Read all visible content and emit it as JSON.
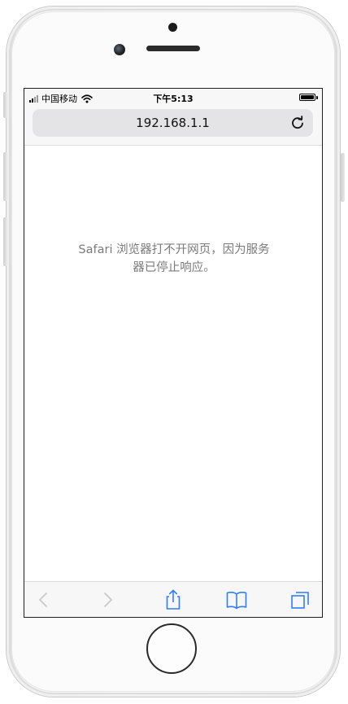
{
  "status_bar": {
    "carrier": "中国移动",
    "time": "下午5:13",
    "icons": {
      "signal": "signal-bars-icon",
      "wifi": "wifi-icon",
      "battery": "battery-icon"
    },
    "battery_level": 1.0
  },
  "address_bar": {
    "url": "192.168.1.1",
    "reload_icon": "reload-icon"
  },
  "page": {
    "error_line1": "Safari 浏览器打不开网页，因为服务",
    "error_line2": "器已停止响应。"
  },
  "toolbar": {
    "items": [
      "back-icon",
      "forward-icon",
      "share-icon",
      "bookmarks-icon",
      "tabs-icon"
    ],
    "enabled_color": "#2f7dfb",
    "disabled_color": "#c8c8cc"
  }
}
